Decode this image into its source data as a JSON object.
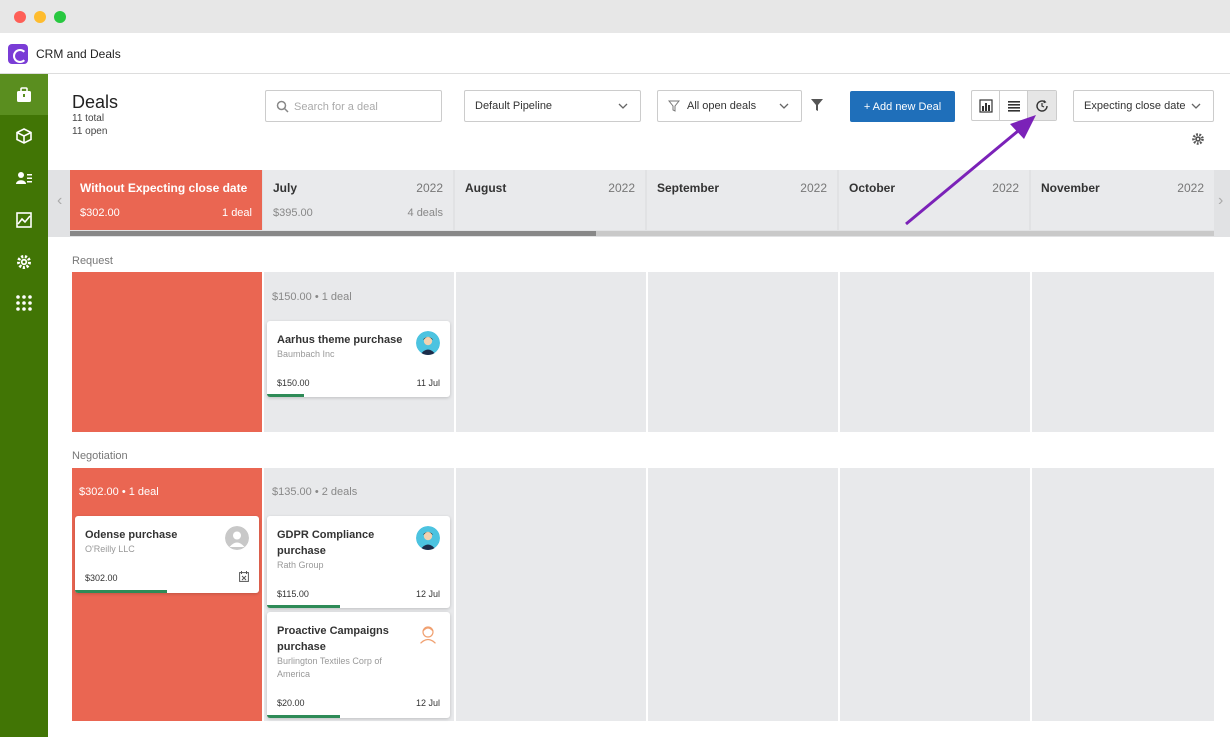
{
  "app": {
    "title": "CRM and Deals"
  },
  "header": {
    "title": "Deals",
    "total": "11 total",
    "open": "11 open",
    "search_placeholder": "Search for a deal",
    "pipeline": "Default Pipeline",
    "filter": "All open deals",
    "add_button": "+ Add new Deal",
    "sort": "Expecting close date"
  },
  "sidebar": {
    "items": [
      {
        "icon": "briefcase-icon",
        "active": true
      },
      {
        "icon": "box-icon"
      },
      {
        "icon": "contacts-icon"
      },
      {
        "icon": "chart-icon"
      },
      {
        "icon": "gear-icon"
      },
      {
        "icon": "apps-grid-icon"
      }
    ]
  },
  "timeline": {
    "columns": [
      {
        "name": "Without Expecting close date",
        "year": "",
        "sum": "$302.00",
        "count": "1 deal"
      },
      {
        "name": "July",
        "year": "2022",
        "sum": "$395.00",
        "count": "4 deals"
      },
      {
        "name": "August",
        "year": "2022",
        "sum": "",
        "count": ""
      },
      {
        "name": "September",
        "year": "2022",
        "sum": "",
        "count": ""
      },
      {
        "name": "October",
        "year": "2022",
        "sum": "",
        "count": ""
      },
      {
        "name": "November",
        "year": "2022",
        "sum": "",
        "count": ""
      }
    ]
  },
  "stages": [
    {
      "name": "Request",
      "nodate_sum": "",
      "july_sum": "$150.00 • 1 deal",
      "cards": [
        {
          "title": "Aarhus theme purchase",
          "company": "Baumbach Inc",
          "amount": "$150.00",
          "date": "11 Jul",
          "progress": 0.2
        }
      ]
    },
    {
      "name": "Negotiation",
      "nodate_sum": "$302.00 • 1 deal",
      "july_sum": "$135.00 • 2 deals",
      "nodate_cards": [
        {
          "title": "Odense purchase",
          "company": "O'Reilly LLC",
          "amount": "$302.00",
          "date": "",
          "progress": 0.5
        }
      ],
      "cards": [
        {
          "title": "GDPR Compliance purchase",
          "company": "Rath Group",
          "amount": "$115.00",
          "date": "12 Jul",
          "progress": 0.4
        },
        {
          "title": "Proactive Campaigns purchase",
          "company": "Burlington Textiles Corp of America",
          "amount": "$20.00",
          "date": "12 Jul",
          "progress": 0.4
        }
      ]
    }
  ],
  "colors": {
    "sidebar": "#417505",
    "no_date": "#ea6652",
    "accent": "#1f6fba",
    "annotation_arrow": "#7b22b8"
  }
}
